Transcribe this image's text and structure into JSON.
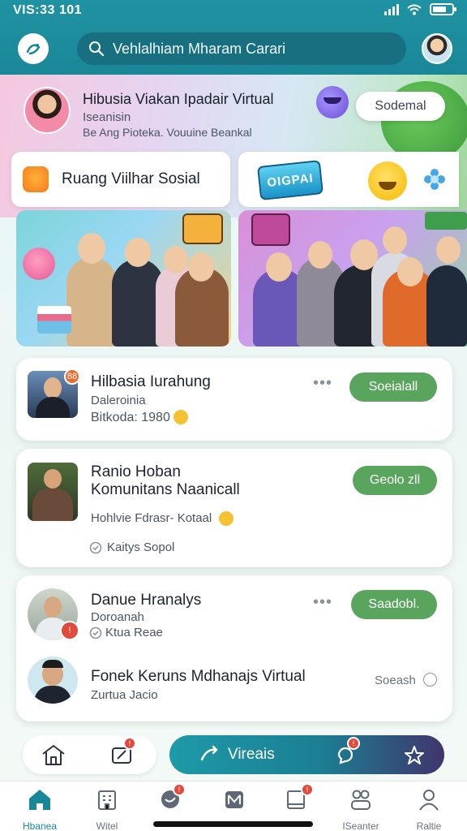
{
  "status_bar": {
    "time": "VIS:33 101"
  },
  "header": {
    "search": {
      "placeholder": "Vehlalhiam Mharam Carari"
    }
  },
  "banner": {
    "title": "Hibusia Viakan Ipadair Virtual",
    "subtitle": "Iseanisin",
    "description": "Be Ang Pioteka. Vouuine Beankal",
    "button": "Sodemal"
  },
  "chips": {
    "left_label": "Ruang Viilhar Sosial",
    "right_badge": "OIGPAI"
  },
  "cards": [
    {
      "title": "Hilbasia Iurahung",
      "subtitle": "Daleroinia",
      "meta": "Bitkoda: 1980",
      "button": "Soeialall",
      "badge": "88"
    },
    {
      "title": "Ranio Hoban",
      "title2": "Komunitans Naanicall",
      "subtitle": "Hohlvie Fdrasr- Kotaal",
      "meta": "Kaitys Sopol",
      "button": "Geolo zll"
    },
    {
      "title": "Danue Hranalys",
      "subtitle": "Doroanah",
      "meta": "Ktua Reae",
      "button": "Saadobl."
    },
    {
      "title": "Fonek Keruns Mdhanajs Virtual",
      "subtitle": "Zurtua Jacio",
      "status": "Soeash"
    }
  ],
  "action_bar": {
    "label": "Vireais"
  },
  "bottom_nav": [
    {
      "label": "Hbanea"
    },
    {
      "label": "Witel"
    },
    {
      "label": ""
    },
    {
      "label": ""
    },
    {
      "label": ""
    },
    {
      "label": "ISeanter"
    },
    {
      "label": "Raltie"
    }
  ],
  "colors": {
    "primary": "#1a8797",
    "accent_green": "#5aa55d",
    "notification": "#e24a3b"
  }
}
